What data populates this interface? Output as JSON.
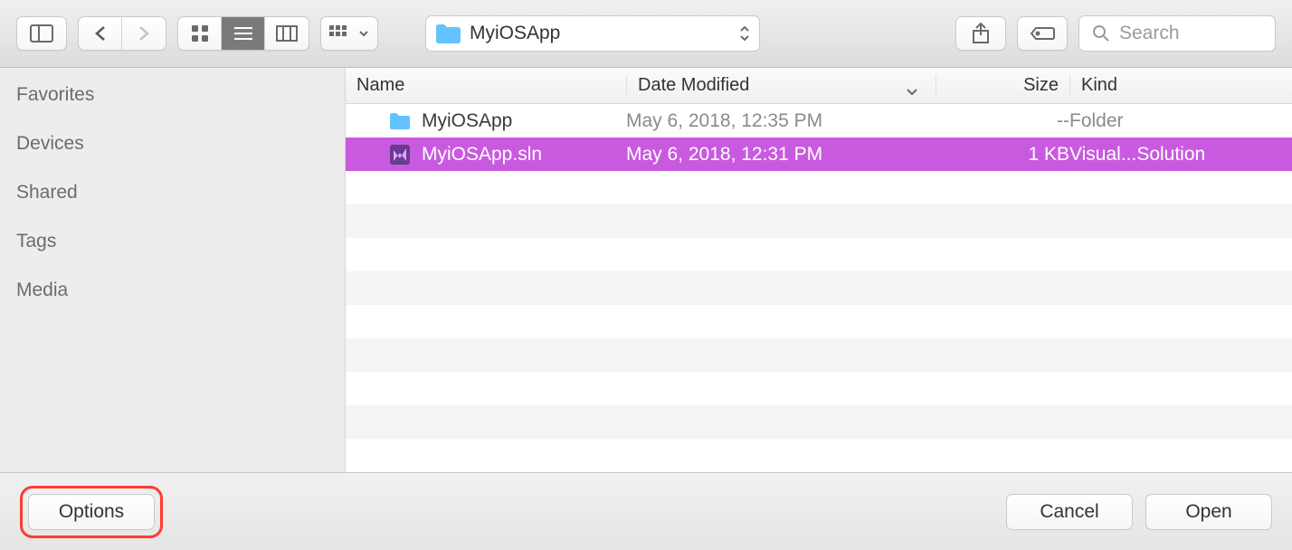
{
  "toolbar": {
    "current_folder": "MyiOSApp",
    "search_placeholder": "Search"
  },
  "sidebar": {
    "sections": {
      "favorites": "Favorites",
      "devices": "Devices",
      "shared": "Shared",
      "tags": "Tags",
      "media": "Media"
    }
  },
  "columns": {
    "name": "Name",
    "date": "Date Modified",
    "size": "Size",
    "kind": "Kind"
  },
  "rows": [
    {
      "name": "MyiOSApp",
      "date": "May 6, 2018, 12:35 PM",
      "size": "--",
      "kind": "Folder",
      "icon": "folder",
      "selected": false
    },
    {
      "name": "MyiOSApp.sln",
      "date": "May 6, 2018, 12:31 PM",
      "size": "1 KB",
      "kind": "Visual...Solution",
      "icon": "vs",
      "selected": true
    }
  ],
  "footer": {
    "options": "Options",
    "cancel": "Cancel",
    "open": "Open"
  }
}
